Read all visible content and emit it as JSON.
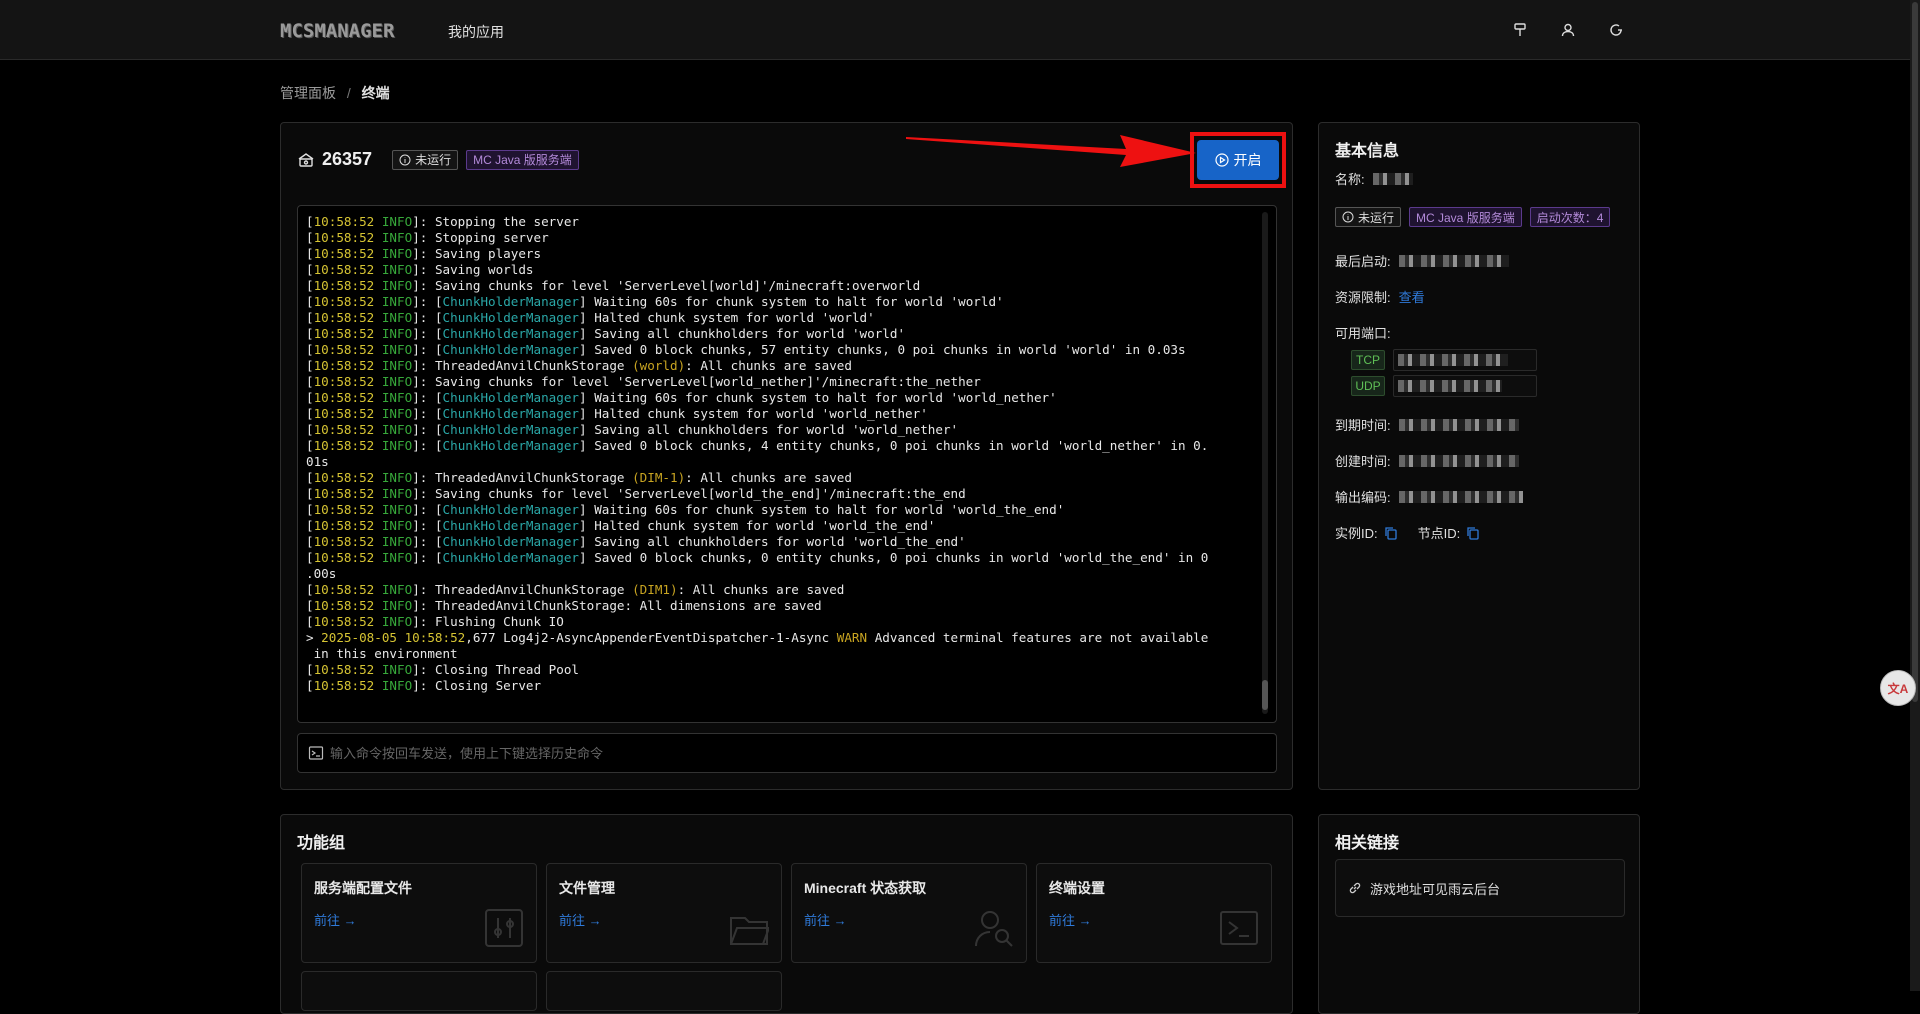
{
  "header": {
    "logo": "MCSMANAGER",
    "nav_label": "我的应用",
    "icons": [
      "brush-icon",
      "user-icon",
      "logout-icon"
    ]
  },
  "breadcrumb": {
    "root": "管理面板",
    "separator": "/",
    "current": "终端"
  },
  "instance": {
    "name": "26357",
    "status_tag": "未运行",
    "type_tag": "MC Java 版服务端",
    "start_label": "开启"
  },
  "console": {
    "lines": [
      {
        "time": "10:58:52",
        "level": "INFO",
        "msg": "Stopping the server"
      },
      {
        "time": "10:58:52",
        "level": "INFO",
        "msg": "Stopping server"
      },
      {
        "time": "10:58:52",
        "level": "INFO",
        "msg": "Saving players"
      },
      {
        "time": "10:58:52",
        "level": "INFO",
        "msg": "Saving worlds"
      },
      {
        "time": "10:58:52",
        "level": "INFO",
        "msg": "Saving chunks for level 'ServerLevel[world]'/minecraft:overworld"
      },
      {
        "time": "10:58:52",
        "level": "INFO",
        "tag": "ChunkHolderManager",
        "msg": "Waiting 60s for chunk system to halt for world 'world'"
      },
      {
        "time": "10:58:52",
        "level": "INFO",
        "tag": "ChunkHolderManager",
        "msg": "Halted chunk system for world 'world'"
      },
      {
        "time": "10:58:52",
        "level": "INFO",
        "tag": "ChunkHolderManager",
        "msg": "Saving all chunkholders for world 'world'"
      },
      {
        "time": "10:58:52",
        "level": "INFO",
        "tag": "ChunkHolderManager",
        "msg": "Saved 0 block chunks, 57 entity chunks, 0 poi chunks in world 'world' in 0.03s"
      },
      {
        "time": "10:58:52",
        "level": "INFO",
        "pre": "ThreadedAnvilChunkStorage ",
        "dim": "(world)",
        "msg": ": All chunks are saved"
      },
      {
        "time": "10:58:52",
        "level": "INFO",
        "msg": "Saving chunks for level 'ServerLevel[world_nether]'/minecraft:the_nether"
      },
      {
        "time": "10:58:52",
        "level": "INFO",
        "tag": "ChunkHolderManager",
        "msg": "Waiting 60s for chunk system to halt for world 'world_nether'"
      },
      {
        "time": "10:58:52",
        "level": "INFO",
        "tag": "ChunkHolderManager",
        "msg": "Halted chunk system for world 'world_nether'"
      },
      {
        "time": "10:58:52",
        "level": "INFO",
        "tag": "ChunkHolderManager",
        "msg": "Saving all chunkholders for world 'world_nether'"
      },
      {
        "time": "10:58:52",
        "level": "INFO",
        "tag": "ChunkHolderManager",
        "msg": "Saved 0 block chunks, 4 entity chunks, 0 poi chunks in world 'world_nether' in 0.",
        "cont": "01s"
      },
      {
        "time": "10:58:52",
        "level": "INFO",
        "pre": "ThreadedAnvilChunkStorage ",
        "dim": "(DIM-1)",
        "msg": ": All chunks are saved"
      },
      {
        "time": "10:58:52",
        "level": "INFO",
        "msg": "Saving chunks for level 'ServerLevel[world_the_end]'/minecraft:the_end"
      },
      {
        "time": "10:58:52",
        "level": "INFO",
        "tag": "ChunkHolderManager",
        "msg": "Waiting 60s for chunk system to halt for world 'world_the_end'"
      },
      {
        "time": "10:58:52",
        "level": "INFO",
        "tag": "ChunkHolderManager",
        "msg": "Halted chunk system for world 'world_the_end'"
      },
      {
        "time": "10:58:52",
        "level": "INFO",
        "tag": "ChunkHolderManager",
        "msg": "Saving all chunkholders for world 'world_the_end'"
      },
      {
        "time": "10:58:52",
        "level": "INFO",
        "tag": "ChunkHolderManager",
        "msg": "Saved 0 block chunks, 0 entity chunks, 0 poi chunks in world 'world_the_end' in 0",
        "cont": ".00s"
      },
      {
        "time": "10:58:52",
        "level": "INFO",
        "pre": "ThreadedAnvilChunkStorage ",
        "dim": "(DIM1)",
        "msg": ": All chunks are saved"
      },
      {
        "time": "10:58:52",
        "level": "INFO",
        "msg": "ThreadedAnvilChunkStorage: All dimensions are saved"
      },
      {
        "time": "10:58:52",
        "level": "INFO",
        "msg": "Flushing Chunk IO"
      },
      {
        "warn": true,
        "date": "2025-08-05 10:58:52",
        "rest": ",677 Log4j2-AsyncAppenderEventDispatcher-1-Async ",
        "level": "WARN",
        "msg": " Advanced terminal features are not available",
        "cont": " in this environment"
      },
      {
        "time": "10:58:52",
        "level": "INFO",
        "msg": "Closing Thread Pool"
      },
      {
        "time": "10:58:52",
        "level": "INFO",
        "msg": "Closing Server"
      }
    ],
    "input_placeholder": "输入命令按回车发送，使用上下键选择历史命令"
  },
  "basic_info": {
    "title": "基本信息",
    "name_label": "名称:",
    "status_tag": "未运行",
    "type_tag": "MC Java 版服务端",
    "start_count_tag": "启动次数：4",
    "last_start_label": "最后启动:",
    "resource_label": "资源限制:",
    "resource_link": "查看",
    "ports_label": "可用端口:",
    "port_tcp": "TCP",
    "port_udp": "UDP",
    "expire_label": "到期时间:",
    "created_label": "创建时间:",
    "encoding_label": "输出编码:",
    "instance_id_label": "实例ID:",
    "node_id_label": "节点ID:"
  },
  "function_group": {
    "title": "功能组",
    "items": [
      {
        "title": "服务端配置文件",
        "go": "前往 →"
      },
      {
        "title": "文件管理",
        "go": "前往 →"
      },
      {
        "title": "Minecraft 状态获取",
        "go": "前往 →"
      },
      {
        "title": "终端设置",
        "go": "前往 →"
      }
    ]
  },
  "related_links": {
    "title": "相关链接",
    "item": "游戏地址可见雨云后台"
  },
  "colors": {
    "accent": "#1764c8",
    "highlight": "#ee1111",
    "purple_tag": "#b38ad9",
    "port_green": "#5fbf56"
  }
}
